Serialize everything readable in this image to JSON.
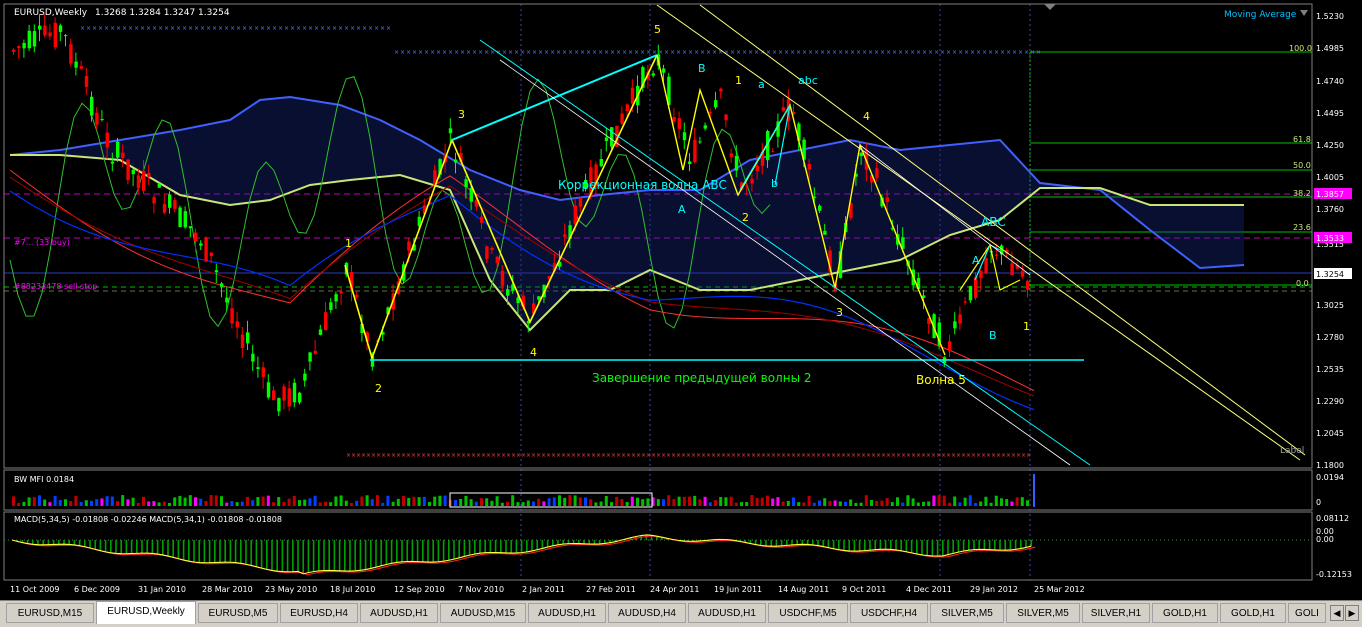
{
  "chart": {
    "title": "EURUSD,Weekly",
    "ohlc": "1.3268 1.3284 1.3247 1.3254",
    "indicator_label": "Moving Average",
    "label_text": "Label",
    "order_label_1": "#7... (33 buy)",
    "order_label_2": "#88233478 sell stop"
  },
  "price_axis": [
    "1.5230",
    "1.4985",
    "1.4740",
    "1.4495",
    "1.4250",
    "1.4005",
    "1.3760",
    "1.3515",
    "1.3270",
    "1.3025",
    "1.2780",
    "1.2535",
    "1.2290",
    "1.2045",
    "1.1800"
  ],
  "price_tags": [
    {
      "value": "1.3857",
      "color": "#ff00ff"
    },
    {
      "value": "1.3533",
      "color": "#ff00ff"
    },
    {
      "value": "1.3254",
      "color": "#000000"
    }
  ],
  "fibo_levels": [
    "100.0",
    "61.8",
    "50.0",
    "38.2",
    "23.6",
    "0.0"
  ],
  "annotations": {
    "wave1_left": "1",
    "wave2_left": "2",
    "wave3_left": "3",
    "wave4_left": "4",
    "wave5_top": "5",
    "correction_text": "Коррекционная волна ABC",
    "A_mid": "A",
    "B_top": "B",
    "wave1_right": "1",
    "a_small": "a",
    "abc_small": "abc",
    "b_small": "b",
    "wave2_right": "2",
    "wave3_right": "3",
    "wave4_right": "4",
    "abc_right": "ABC",
    "A_right": "A",
    "B_right": "B",
    "wave1_end": "1",
    "completion_text": "Завершение предыдущей волны 2",
    "wave5_bottom": "Волна 5"
  },
  "mfi": {
    "label": "BW MFI 0.0184",
    "axis": [
      "0.0194",
      "0"
    ]
  },
  "macd": {
    "label": "MACD(5,34,5) -0.01808 -0.02246  MACD(5,34,1) -0.01808 -0.01808",
    "axis": [
      "0.08112",
      "0.00",
      "0.00",
      "-0.12153"
    ]
  },
  "time_axis": [
    "11 Oct 2009",
    "6 Dec 2009",
    "31 Jan 2010",
    "28 Mar 2010",
    "23 May 2010",
    "18 Jul 2010",
    "12 Sep 2010",
    "7 Nov 2010",
    "2 Jan 2011",
    "27 Feb 2011",
    "24 Apr 2011",
    "19 Jun 2011",
    "14 Aug 2011",
    "9 Oct 2011",
    "4 Dec 2011",
    "29 Jan 2012",
    "25 Mar 2012"
  ],
  "tabs": [
    "EURUSD,M15",
    "EURUSD,Weekly",
    "EURUSD,M5",
    "EURUSD,H4",
    "AUDUSD,H1",
    "AUDUSD,M15",
    "AUDUSD,H1",
    "AUDUSD,H4",
    "AUDUSD,H1",
    "USDCHF,M5",
    "USDCHF,H4",
    "SILVER,M5",
    "SILVER,M5",
    "SILVER,H1",
    "GOLD,H1",
    "GOLD,H1",
    "GOLI"
  ],
  "active_tab": "EURUSD,Weekly",
  "colors": {
    "bull": "#00ff00",
    "bear": "#ff0000",
    "cloud": "#3c50ff",
    "kijun": "#c8e678",
    "cyan": "#00ffff",
    "gold": "#ffff00"
  }
}
